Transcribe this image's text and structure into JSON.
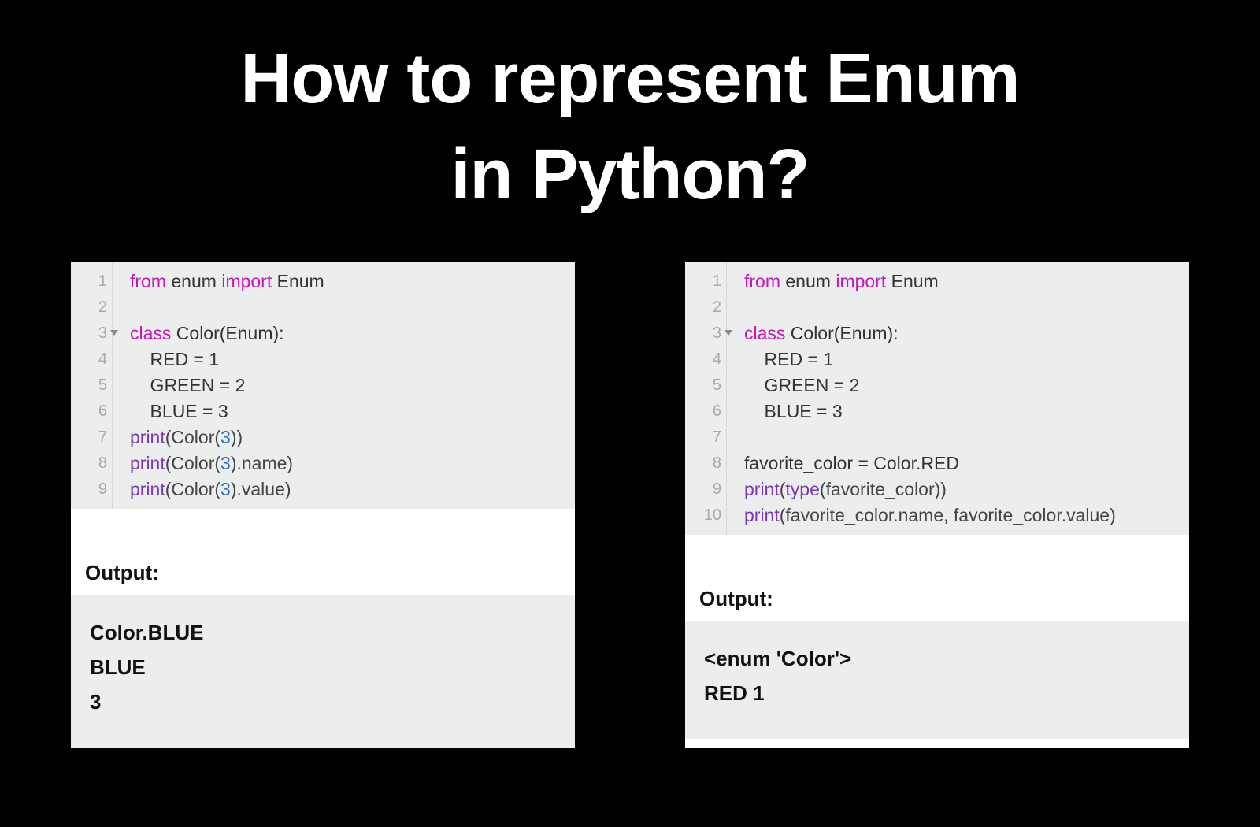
{
  "title_line1": "How to represent Enum",
  "title_line2": "in Python?",
  "left": {
    "lines": [
      1,
      2,
      3,
      4,
      5,
      6,
      7,
      8,
      9
    ],
    "fold_line": 3,
    "code": {
      "l1_from": "from",
      "l1_enum": " enum ",
      "l1_import": "import",
      "l1_Enum": " Enum",
      "l2": "",
      "l3_class": "class",
      "l3_rest": " Color(Enum):",
      "l4": "    RED = 1",
      "l5": "    GREEN = 2",
      "l6": "    BLUE = 3",
      "l7_print": "print",
      "l7_rest": "(Color(",
      "l7_num": "3",
      "l7_close": "))",
      "l8_print": "print",
      "l8_rest": "(Color(",
      "l8_num": "3",
      "l8_tail": ").name)",
      "l9_print": "print",
      "l9_rest": "(Color(",
      "l9_num": "3",
      "l9_tail": ").value)"
    },
    "output_label": "Output:",
    "output": [
      "Color.BLUE",
      "BLUE",
      "3"
    ]
  },
  "right": {
    "lines": [
      1,
      2,
      3,
      4,
      5,
      6,
      7,
      8,
      9,
      10
    ],
    "fold_line": 3,
    "code": {
      "l1_from": "from",
      "l1_enum": " enum ",
      "l1_import": "import",
      "l1_Enum": " Enum",
      "l2": "",
      "l3_class": "class",
      "l3_rest": " Color(Enum):",
      "l4": "    RED = 1",
      "l5": "    GREEN = 2",
      "l6": "    BLUE = 3",
      "l7": "",
      "l8": "favorite_color = Color.RED",
      "l9_print": "print",
      "l9_open": "(",
      "l9_type": "type",
      "l9_rest": "(favorite_color))",
      "l10_print": "print",
      "l10_rest": "(favorite_color.name, favorite_color.value)"
    },
    "output_label": "Output:",
    "output": [
      "<enum 'Color'>",
      "RED 1"
    ]
  }
}
